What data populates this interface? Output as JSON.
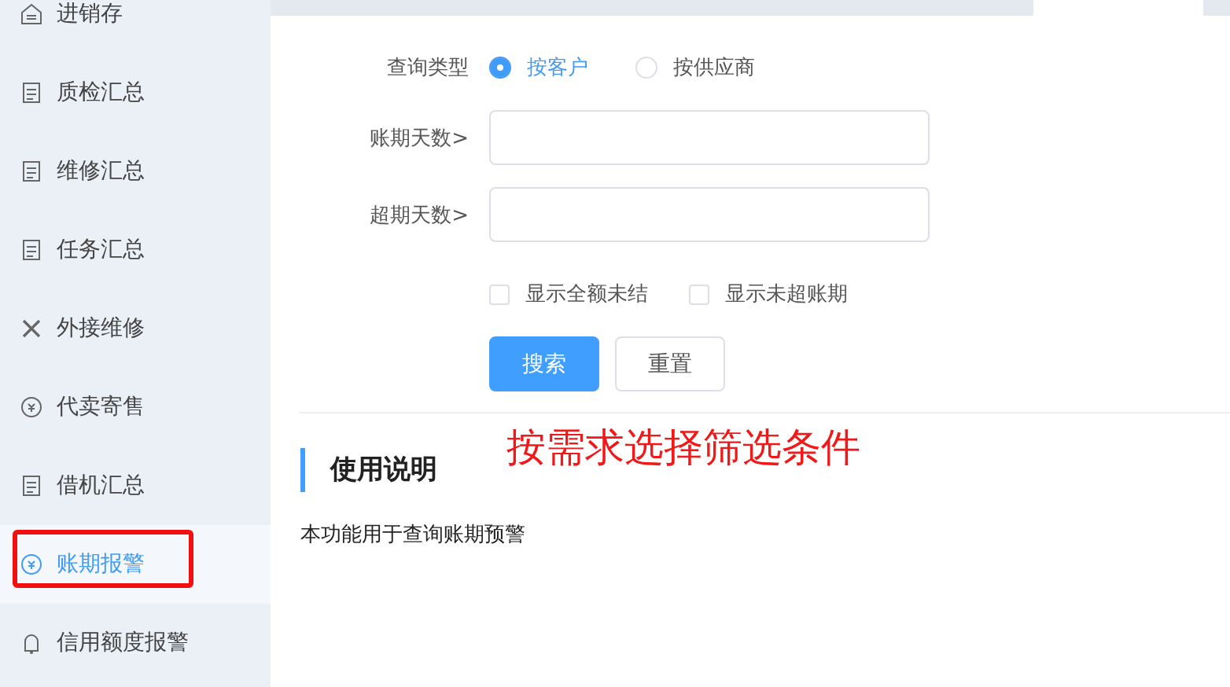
{
  "sidebar": {
    "items": [
      {
        "label": "进销存",
        "selected": false,
        "highlighted": false
      },
      {
        "label": "质检汇总",
        "selected": false,
        "highlighted": false
      },
      {
        "label": "维修汇总",
        "selected": false,
        "highlighted": false
      },
      {
        "label": "任务汇总",
        "selected": false,
        "highlighted": false
      },
      {
        "label": "外接维修",
        "selected": false,
        "highlighted": false
      },
      {
        "label": "代卖寄售",
        "selected": false,
        "highlighted": false
      },
      {
        "label": "借机汇总",
        "selected": false,
        "highlighted": false
      },
      {
        "label": "账期报警",
        "selected": true,
        "highlighted": true
      },
      {
        "label": "信用额度报警",
        "selected": false,
        "highlighted": false
      }
    ]
  },
  "form": {
    "query_type": {
      "label": "查询类型",
      "options": [
        {
          "label": "按客户",
          "selected": true
        },
        {
          "label": "按供应商",
          "selected": false
        }
      ]
    },
    "fields": [
      {
        "label": "账期天数>"
      },
      {
        "label": "超期天数>"
      }
    ],
    "checkboxes": [
      {
        "label": "显示全额未结",
        "checked": false
      },
      {
        "label": "显示未超账期",
        "checked": false
      }
    ],
    "buttons": [
      {
        "label": "搜索",
        "kind": "primary"
      },
      {
        "label": "重置",
        "kind": "default"
      }
    ]
  },
  "annotation": "按需求选择筛选条件",
  "help": {
    "title": "使用说明",
    "text": "本功能用于查询账期预警"
  }
}
